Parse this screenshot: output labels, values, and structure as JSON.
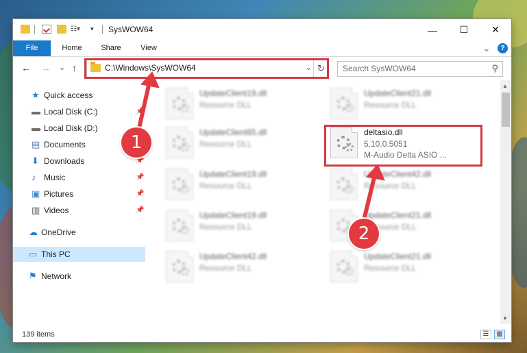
{
  "window": {
    "title": "SysWOW64",
    "controls": {
      "minimize": "—",
      "maximize": "☐",
      "close": "✕"
    }
  },
  "ribbon": {
    "tabs": [
      "File",
      "Home",
      "Share",
      "View"
    ],
    "help": "?",
    "expand": "⌄"
  },
  "nav": {
    "back": "←",
    "forward": "→",
    "recent": "⌄",
    "up": "↑",
    "address": "C:\\Windows\\SysWOW64",
    "refresh": "↻",
    "search_placeholder": "Search SysWOW64"
  },
  "sidebar": {
    "items": [
      {
        "label": "Quick access",
        "icon": "star-icon",
        "pinned": false
      },
      {
        "label": "Local Disk (C:)",
        "icon": "drive-icon",
        "pinned": true
      },
      {
        "label": "Local Disk (D:)",
        "icon": "drive-icon",
        "pinned": false
      },
      {
        "label": "Documents",
        "icon": "documents-icon",
        "pinned": true
      },
      {
        "label": "Downloads",
        "icon": "downloads-icon",
        "pinned": true
      },
      {
        "label": "Music",
        "icon": "music-icon",
        "pinned": true
      },
      {
        "label": "Pictures",
        "icon": "pictures-icon",
        "pinned": true
      },
      {
        "label": "Videos",
        "icon": "videos-icon",
        "pinned": true
      },
      {
        "label": "OneDrive",
        "icon": "onedrive-icon",
        "pinned": false
      },
      {
        "label": "This PC",
        "icon": "computer-icon",
        "pinned": false,
        "selected": true
      },
      {
        "label": "Network",
        "icon": "network-icon",
        "pinned": false
      }
    ]
  },
  "files": [
    {
      "name": "UpdateClient19.dll",
      "sub": "Resource DLL",
      "blurred": true
    },
    {
      "name": "UpdateClient21.dll",
      "sub": "Resource DLL",
      "blurred": true
    },
    {
      "name": "UpdateClient65.dll",
      "sub": "Resource DLL",
      "blurred": true
    },
    {
      "name": "deltasio.dll",
      "sub": "5.10.0.5051",
      "sub2": "M-Audio Delta ASIO ...",
      "blurred": false
    },
    {
      "name": "UpdateClient19.dll",
      "sub": "Resource DLL",
      "blurred": true
    },
    {
      "name": "UpdateClient42.dll",
      "sub": "Resource DLL",
      "blurred": true
    },
    {
      "name": "UpdateClient19.dll",
      "sub": "Resource DLL",
      "blurred": true
    },
    {
      "name": "UpdateClient21.dll",
      "sub": "Resource DLL",
      "blurred": true
    },
    {
      "name": "UpdateClient42.dll",
      "sub": "Resource DLL",
      "blurred": true
    },
    {
      "name": "UpdateClient21.dll",
      "sub": "Resource DLL",
      "blurred": true
    }
  ],
  "status": {
    "count": "139 items"
  },
  "annotations": {
    "badge1": "1",
    "badge2": "2",
    "color": "#e13a41"
  }
}
